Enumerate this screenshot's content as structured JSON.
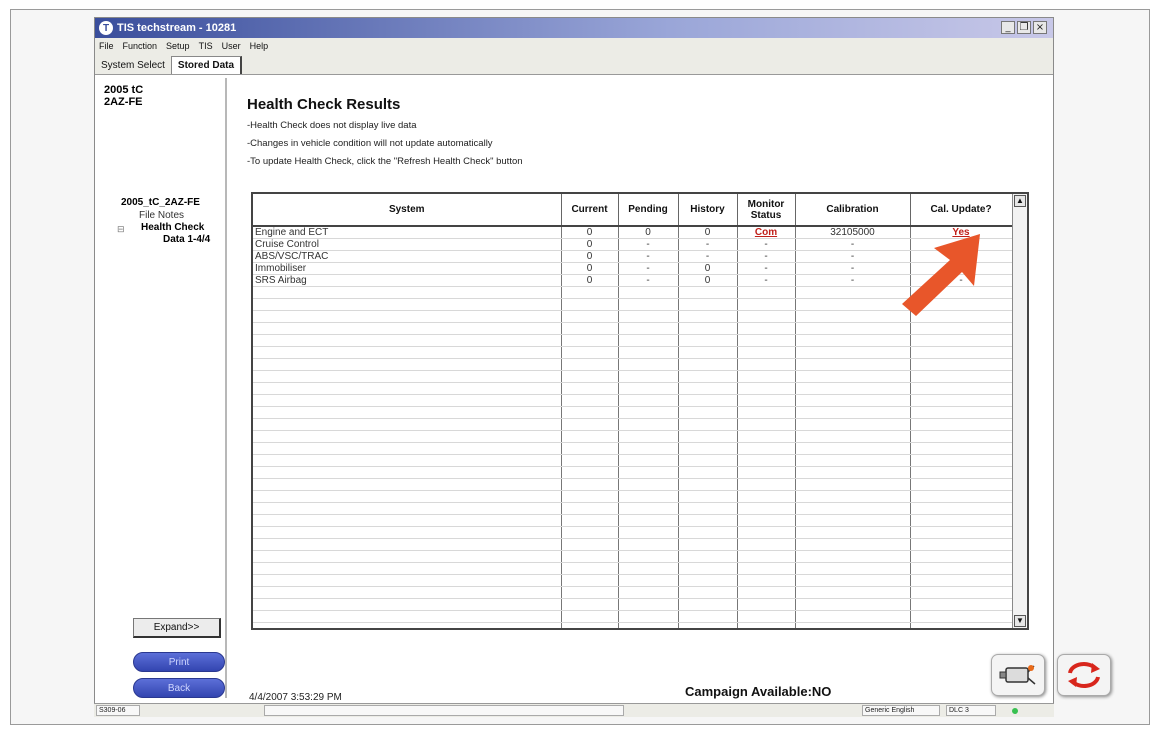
{
  "window": {
    "title": "TIS techstream - 10281",
    "controls": [
      "_",
      "❐",
      "×"
    ]
  },
  "menu": [
    "File",
    "Function",
    "Setup",
    "TIS",
    "User",
    "Help"
  ],
  "tabs": [
    {
      "label": "System Select",
      "active": false
    },
    {
      "label": "Stored Data",
      "active": true
    }
  ],
  "sidebar": {
    "vehicle_line1": "2005 tC",
    "vehicle_line2": "2AZ-FE",
    "tree_root": "2005_tC_2AZ-FE",
    "tree_file_notes": "File Notes",
    "tree_health_check": "Health Check",
    "tree_data": "Data 1-4/4",
    "expand_label": "Expand>>",
    "print_label": "Print",
    "back_label": "Back"
  },
  "main": {
    "title": "Health Check Results",
    "notes": [
      "-Health Check does not display live data",
      "-Changes in vehicle condition will not update automatically",
      "-To update Health Check, click the \"Refresh Health Check\" button"
    ],
    "columns": [
      "System",
      "Current",
      "Pending",
      "History",
      "Monitor Status",
      "Calibration",
      "Cal. Update?"
    ],
    "rows": [
      {
        "system": "Engine and ECT",
        "current": "0",
        "pending": "0",
        "history": "0",
        "monitor": "Com",
        "calibration": "32105000",
        "update": "Yes"
      },
      {
        "system": "Cruise Control",
        "current": "0",
        "pending": "-",
        "history": "-",
        "monitor": "-",
        "calibration": "-",
        "update": "-"
      },
      {
        "system": "ABS/VSC/TRAC",
        "current": "0",
        "pending": "-",
        "history": "-",
        "monitor": "-",
        "calibration": "-",
        "update": "-"
      },
      {
        "system": "Immobiliser",
        "current": "0",
        "pending": "-",
        "history": "0",
        "monitor": "-",
        "calibration": "-",
        "update": "-"
      },
      {
        "system": "SRS Airbag",
        "current": "0",
        "pending": "-",
        "history": "0",
        "monitor": "-",
        "calibration": "-",
        "update": "-"
      }
    ],
    "timestamp": "4/4/2007 3:53:29 PM",
    "campaign": "Campaign Available:NO"
  },
  "statusbar": {
    "code": "S309-06",
    "language": "Generic English",
    "connection": "DLC 3"
  },
  "colors": {
    "highlight_red": "#c0201a",
    "pointer_arrow": "#e8562a",
    "title_blue": "#3a4e9c"
  },
  "icons": [
    "ecu-connector-icon",
    "refresh-arrows-icon",
    "pointer-arrow-icon"
  ]
}
